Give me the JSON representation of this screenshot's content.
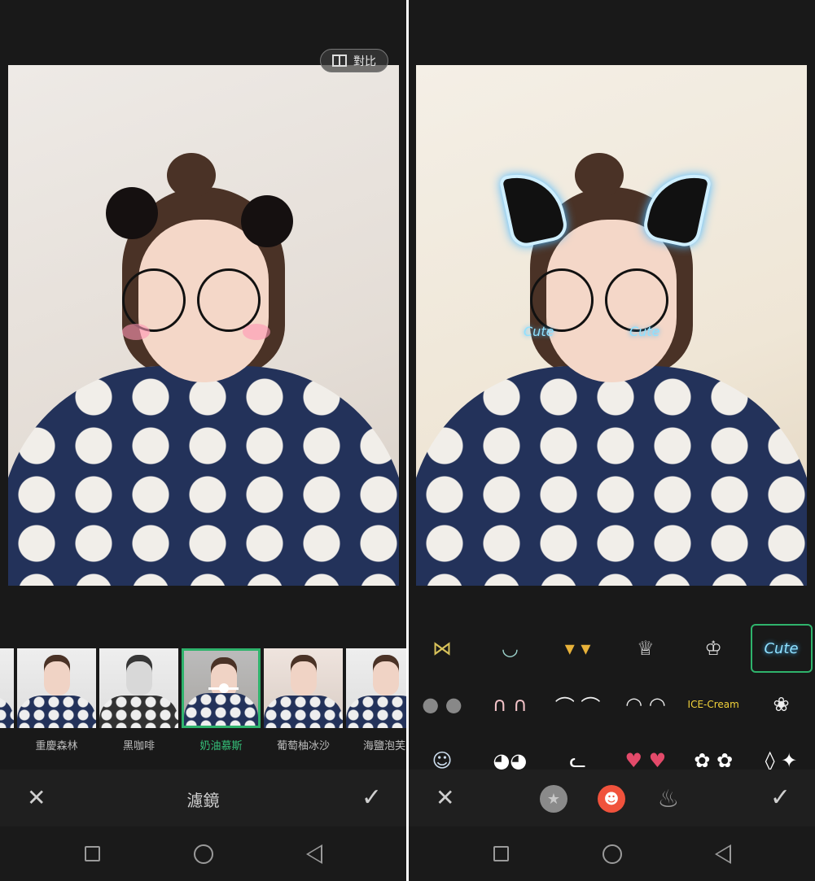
{
  "left": {
    "compare_label": "對比",
    "filters": [
      {
        "label": "",
        "selected": false
      },
      {
        "label": "重慶森林",
        "selected": false
      },
      {
        "label": "黑咖啡",
        "selected": false
      },
      {
        "label": "奶油慕斯",
        "selected": true
      },
      {
        "label": "葡萄柚冰沙",
        "selected": false
      },
      {
        "label": "海鹽泡芙",
        "selected": false
      }
    ],
    "title": "濾鏡",
    "cancel_icon": "close-icon",
    "confirm_icon": "check-icon"
  },
  "right": {
    "sticker_overlay_text": "Cute",
    "stickers": [
      {
        "name": "bow-headband",
        "glyph": "⋈"
      },
      {
        "name": "animal-headband",
        "glyph": "◡"
      },
      {
        "name": "bells",
        "glyph": "▾ ▾"
      },
      {
        "name": "crown",
        "glyph": "♕"
      },
      {
        "name": "tiara",
        "glyph": "♔"
      },
      {
        "name": "cute-cat-glow",
        "glyph": "Cute",
        "selected": true
      },
      {
        "name": "mouse-ears",
        "glyph": "● ●"
      },
      {
        "name": "bunny-ears",
        "glyph": "∩ ∩"
      },
      {
        "name": "cat-ears",
        "glyph": "⌒ ⌒"
      },
      {
        "name": "cat-face-blush",
        "glyph": "◠ ◠"
      },
      {
        "name": "ice-cream",
        "glyph": "ICE-Cream"
      },
      {
        "name": "pompom",
        "glyph": "❀"
      },
      {
        "name": "bird-headphones",
        "glyph": "☺"
      },
      {
        "name": "panda",
        "glyph": "◕◕"
      },
      {
        "name": "white-cat",
        "glyph": "ᓚ"
      },
      {
        "name": "cherries",
        "glyph": "♥ ♥"
      },
      {
        "name": "flowers",
        "glyph": "✿ ✿"
      },
      {
        "name": "sparkle",
        "glyph": "◊ ✦"
      }
    ],
    "tabs": [
      {
        "name": "favorites",
        "glyph": "★",
        "color": "#8a8a8a"
      },
      {
        "name": "face-stickers",
        "glyph": "☻",
        "color": "#f0523c",
        "active": true
      },
      {
        "name": "hot",
        "glyph": "♨",
        "color": "#8a8a8a"
      }
    ]
  },
  "accent_color": "#2fb36c"
}
